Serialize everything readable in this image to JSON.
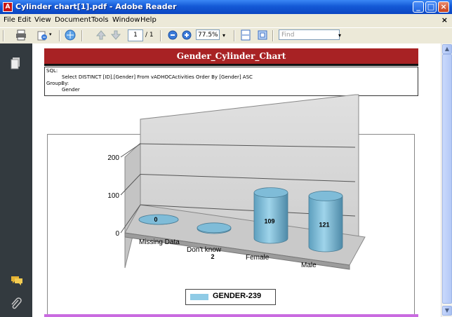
{
  "window": {
    "title": "Cylinder chart[1].pdf - Adobe Reader",
    "app_icon_letter": "A"
  },
  "menu": {
    "items": [
      "File",
      "Edit",
      "View",
      "Document",
      "Tools",
      "Window",
      "Help"
    ],
    "close_glyph": "×"
  },
  "toolbar": {
    "icons": [
      "print-icon",
      "email-icon",
      "search-documents-icon",
      "previous-page-icon",
      "next-page-icon",
      "zoom-out-icon",
      "zoom-in-icon",
      "fit-width-icon",
      "fit-page-icon"
    ],
    "page_current": "1",
    "page_total": "/ 1",
    "zoom": "77.5%",
    "find_placeholder": "Find"
  },
  "document": {
    "title": "Gender_Cylinder_Chart",
    "sql_label": "SQL:",
    "sql_text": "Select  DISTINCT [ID].[Gender] From vADHOCActivities  Order By [Gender] ASC",
    "groupby_label": "GroupBy:",
    "groupby_value": "Gender",
    "legend_label": "GENDER-239"
  },
  "colors": {
    "title_bar_bg": "#a82224",
    "cylinder": "#8fcbe6",
    "xp_blue": "#1459d6"
  },
  "chart_data": {
    "type": "bar",
    "style": "3d-cylinder",
    "categories": [
      "Missing Data",
      "Don't know",
      "Female",
      "Male"
    ],
    "series": [
      {
        "name": "GENDER-239",
        "values": [
          0,
          2,
          109,
          121
        ]
      }
    ],
    "yticks": [
      "0",
      "100",
      "200"
    ],
    "ylim": [
      0,
      200
    ],
    "grid": true,
    "legend": "bottom-center"
  }
}
